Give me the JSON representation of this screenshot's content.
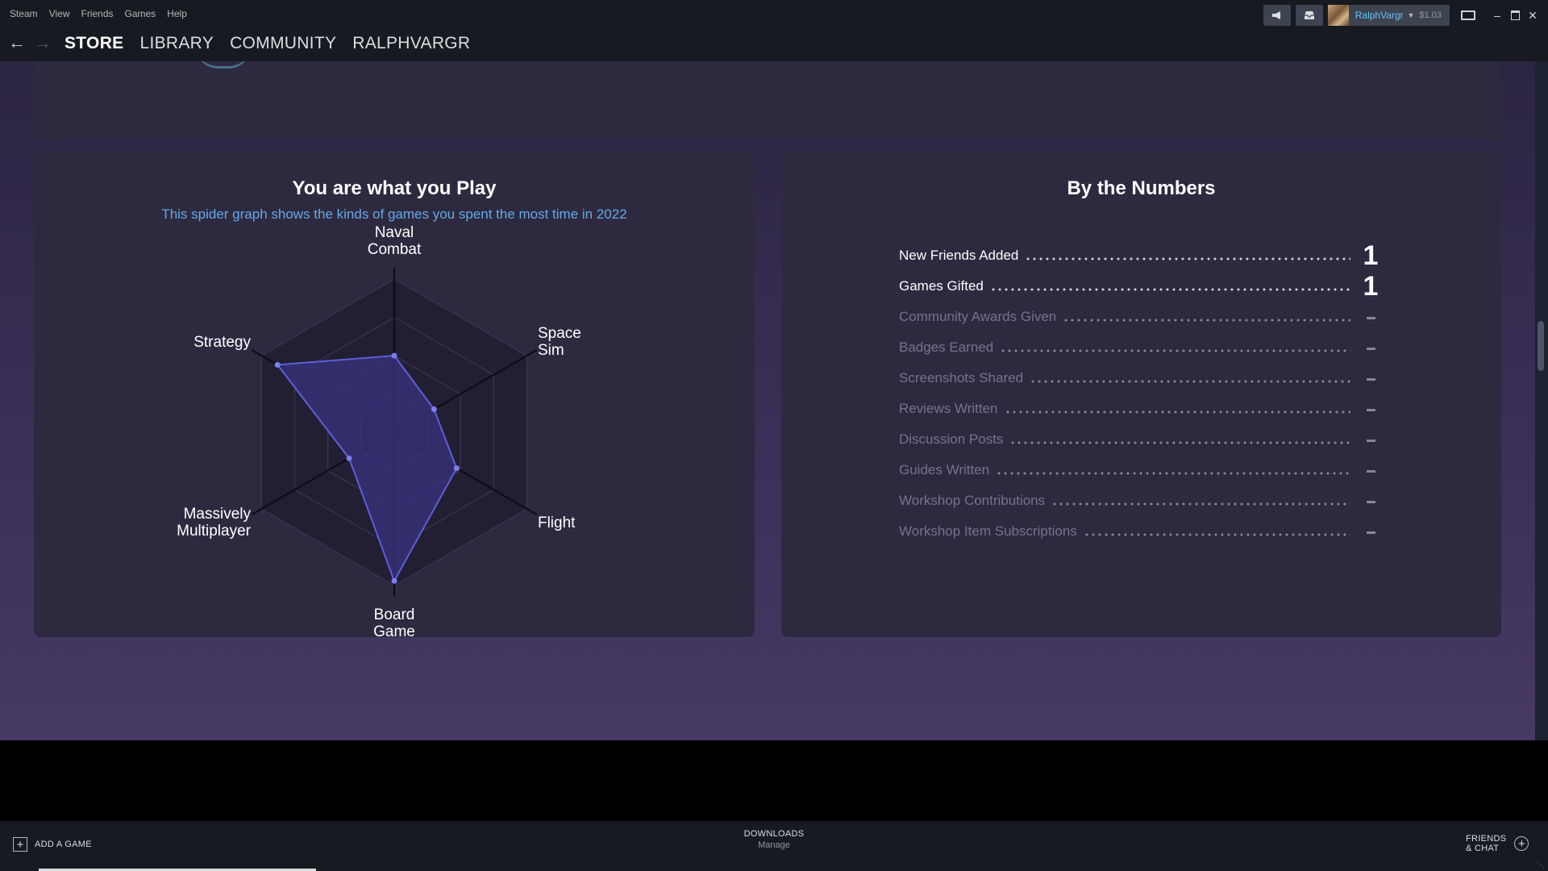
{
  "menubar": {
    "items": [
      "Steam",
      "View",
      "Friends",
      "Games",
      "Help"
    ],
    "account_name": "RalphVargr",
    "wallet": "$1.03",
    "icons": {
      "announce": "megaphone-icon",
      "notifications": "inbox-icon",
      "big_picture": "monitor-icon",
      "minimize": "minimize-icon",
      "maximize": "maximize-icon",
      "close": "close-icon"
    }
  },
  "navbar": {
    "tabs": [
      "STORE",
      "LIBRARY",
      "COMMUNITY",
      "RALPHVARGR"
    ],
    "active_tab": "STORE"
  },
  "spider": {
    "title": "You are what you Play",
    "subtitle": "This spider graph shows the kinds of games you spent the most time in 2022"
  },
  "chart_data": {
    "type": "radar",
    "axes": [
      {
        "line1": "Naval",
        "line2": "Combat"
      },
      {
        "line1": "Space",
        "line2": "Sim"
      },
      {
        "line1": "Flight",
        "line2": ""
      },
      {
        "line1": "Board",
        "line2": "Game"
      },
      {
        "line1": "Massively",
        "line2": "Multiplayer"
      },
      {
        "line1": "Strategy",
        "line2": ""
      }
    ],
    "values": [
      0.5,
      0.3,
      0.47,
      0.97,
      0.34,
      0.88
    ],
    "rings": 4,
    "colors": {
      "fill": "#3b3380",
      "stroke": "#5c5fd8",
      "point": "#7a80ee",
      "grid": "#3a3550",
      "axis": "#0e0c18",
      "background": "#221f33"
    }
  },
  "numbers": {
    "title": "By the Numbers",
    "stats": [
      {
        "label": "New Friends Added",
        "value": "1",
        "active": true
      },
      {
        "label": "Games Gifted",
        "value": "1",
        "active": true
      },
      {
        "label": "Community Awards Given",
        "value": "",
        "active": false
      },
      {
        "label": "Badges Earned",
        "value": "",
        "active": false
      },
      {
        "label": "Screenshots Shared",
        "value": "",
        "active": false
      },
      {
        "label": "Reviews Written",
        "value": "",
        "active": false
      },
      {
        "label": "Discussion Posts",
        "value": "",
        "active": false
      },
      {
        "label": "Guides Written",
        "value": "",
        "active": false
      },
      {
        "label": "Workshop Contributions",
        "value": "",
        "active": false
      },
      {
        "label": "Workshop Item Subscriptions",
        "value": "",
        "active": false
      }
    ]
  },
  "bottombar": {
    "add_game": "ADD A GAME",
    "downloads_title": "DOWNLOADS",
    "downloads_sub": "Manage",
    "friends_line1": "FRIENDS",
    "friends_line2": "& CHAT"
  }
}
